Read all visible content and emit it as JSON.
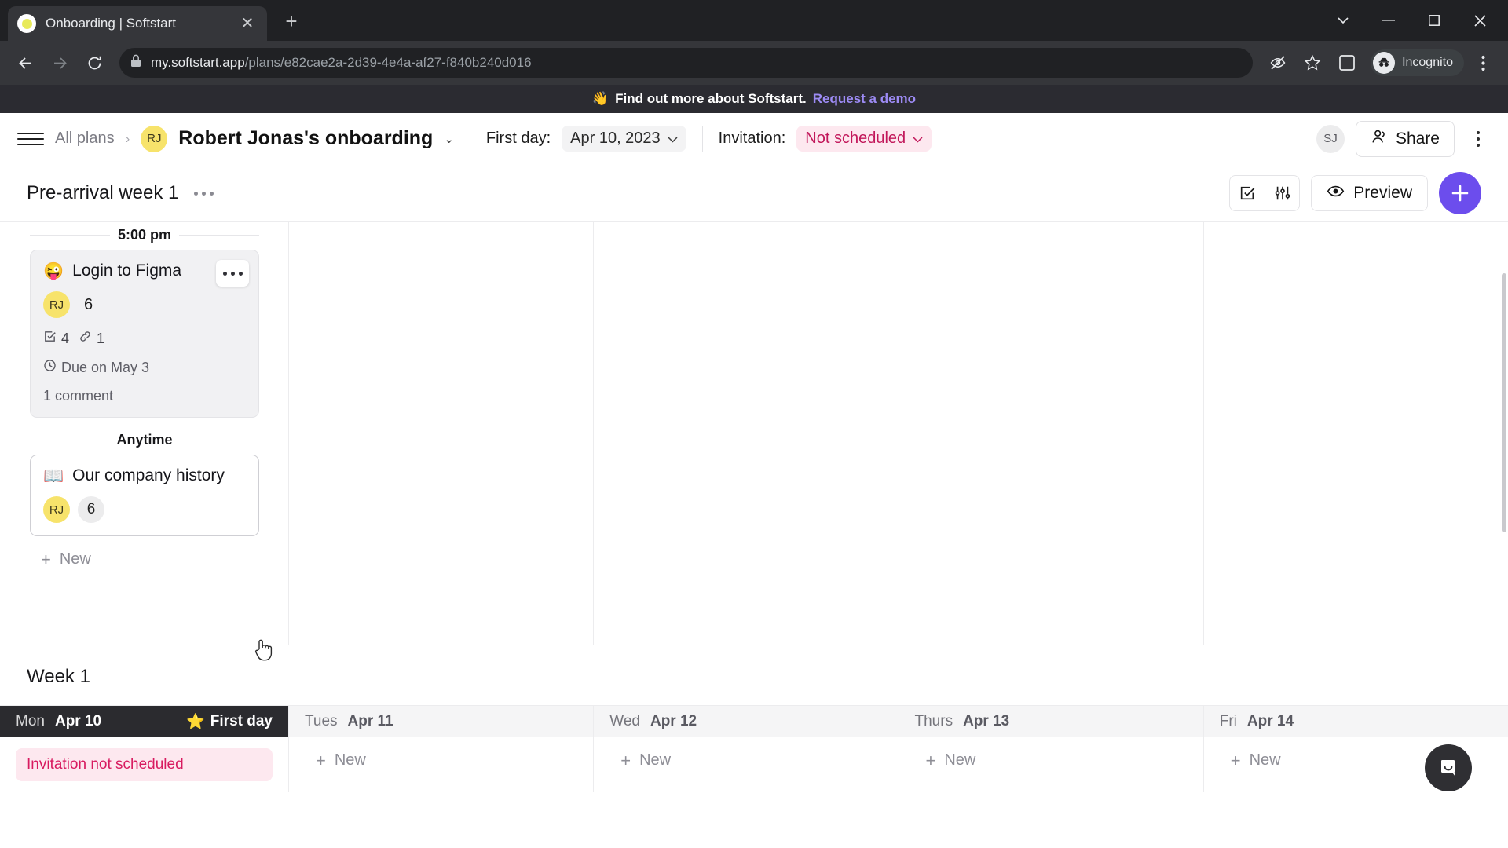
{
  "browser": {
    "tab_title": "Onboarding | Softstart",
    "close_tab_label": "✕",
    "new_tab_label": "+",
    "url_host": "my.softstart.app",
    "url_path": "/plans/e82cae2a-2d39-4e4a-af27-f840b240d016",
    "incognito_label": "Incognito",
    "icons": {
      "favicon": "softstart-logo",
      "back": "back-arrow-icon",
      "forward": "forward-arrow-icon",
      "reload": "reload-icon",
      "lock": "lock-icon",
      "tracking": "eye-slash-icon",
      "bookmark": "star-icon",
      "side_panel": "side-panel-icon",
      "menu": "three-dot-menu-icon",
      "minimize": "minimize-icon",
      "maximize": "maximize-icon",
      "close": "close-window-icon",
      "tab_search": "tab-search-chevron-icon"
    }
  },
  "promo": {
    "emoji": "👋",
    "text": "Find out more about Softstart.",
    "link": "Request a demo"
  },
  "app_header": {
    "all_plans": "All plans",
    "separator": "›",
    "plan_avatar": "RJ",
    "plan_title": "Robert Jonas's onboarding",
    "plan_chevron": "⌄",
    "first_day_label": "First day:",
    "first_day_value": "Apr 10, 2023",
    "invitation_label": "Invitation:",
    "invitation_value": "Not scheduled",
    "user_avatar": "SJ",
    "share_label": "Share"
  },
  "section": {
    "title": "Pre-arrival week 1",
    "preview_label": "Preview",
    "add_label": "+",
    "icons": [
      "checkbox-square-icon",
      "filter-sliders-icon",
      "eye-icon"
    ]
  },
  "cards": {
    "time_divider": "5:00 pm",
    "anytime_divider": "Anytime",
    "new_label": "New",
    "items": [
      {
        "emoji": "😜",
        "title": "Login to Figma",
        "avatar": "RJ",
        "count": "6",
        "tasks": "4",
        "links": "1",
        "due": "Due on May 3",
        "comments": "1 comment"
      },
      {
        "emoji": "📖",
        "title": "Our company history",
        "avatar": "RJ",
        "count": "6"
      }
    ]
  },
  "week": {
    "label": "Week 1",
    "new_label": "New",
    "first_day_badge": "First day",
    "first_day_star": "⭐",
    "invitation_warning": "Invitation not scheduled",
    "days": [
      {
        "dow": "Mon",
        "date": "Apr 10"
      },
      {
        "dow": "Tues",
        "date": "Apr 11"
      },
      {
        "dow": "Wed",
        "date": "Apr 12"
      },
      {
        "dow": "Thurs",
        "date": "Apr 13"
      },
      {
        "dow": "Fri",
        "date": "Apr 14"
      }
    ]
  },
  "colors": {
    "accent": "#6c4ded",
    "avatar_yellow": "#f7e36b",
    "pill_pink_bg": "#fde8ef",
    "pill_pink_text": "#c2185b",
    "dark_header": "#2b2b2f",
    "promo_link": "#9d8bf5"
  }
}
